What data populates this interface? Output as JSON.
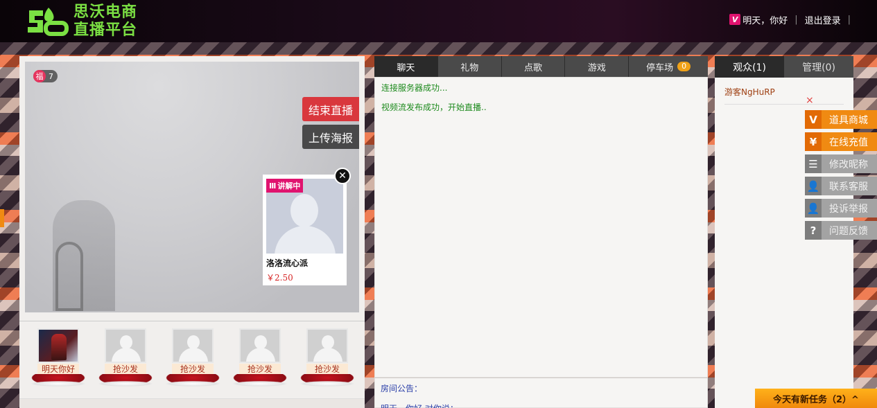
{
  "header": {
    "logo_line1": "思沃电商",
    "logo_line2": "直播平台",
    "user_badge": "V",
    "greeting": "明天，你好",
    "logout": "退出登录",
    "separator": "|"
  },
  "video": {
    "fu_icon": "福",
    "fu_count": "7",
    "end_live_label": "结束直播",
    "upload_poster_label": "上传海报",
    "product": {
      "tag": "讲解中",
      "name": "洛洛流心派",
      "price": "￥2.50",
      "close_icon": "close-icon"
    }
  },
  "seats": [
    {
      "label": "明天你好",
      "type": "user"
    },
    {
      "label": "抢沙发",
      "type": "empty"
    },
    {
      "label": "抢沙发",
      "type": "empty"
    },
    {
      "label": "抢沙发",
      "type": "empty"
    },
    {
      "label": "抢沙发",
      "type": "empty"
    }
  ],
  "chat": {
    "tabs": [
      "聊天",
      "礼物",
      "点歌",
      "游戏",
      "停车场"
    ],
    "parking_count": "0",
    "messages": [
      "连接服务器成功...",
      "视频流发布成功，开始直播.."
    ],
    "announcement_label": "房间公告：",
    "announcement_msg": "明天，你好 对你说："
  },
  "viewers": {
    "tab_audience": "观众(1)",
    "tab_admin": "管理(0)",
    "list": [
      "游客NgHuRP"
    ]
  },
  "side_menu": {
    "close": "×",
    "items": [
      {
        "icon": "V",
        "label": "道具商城",
        "style": "orange"
      },
      {
        "icon": "¥",
        "label": "在线充值",
        "style": "orange"
      },
      {
        "icon": "☰",
        "label": "修改昵称",
        "style": "gray"
      },
      {
        "icon": "👤",
        "label": "联系客服",
        "style": "gray"
      },
      {
        "icon": "👤",
        "label": "投诉举报",
        "style": "gray"
      },
      {
        "icon": "?",
        "label": "问题反馈",
        "style": "gray"
      }
    ]
  },
  "task_bar": "今天有新任务（2）^",
  "colors": {
    "accent_red": "#d9373d",
    "accent_orange": "#f08a12",
    "logo_green": "#7be043",
    "chat_green": "#1d8a1d",
    "announce_blue": "#2a3ea8"
  }
}
